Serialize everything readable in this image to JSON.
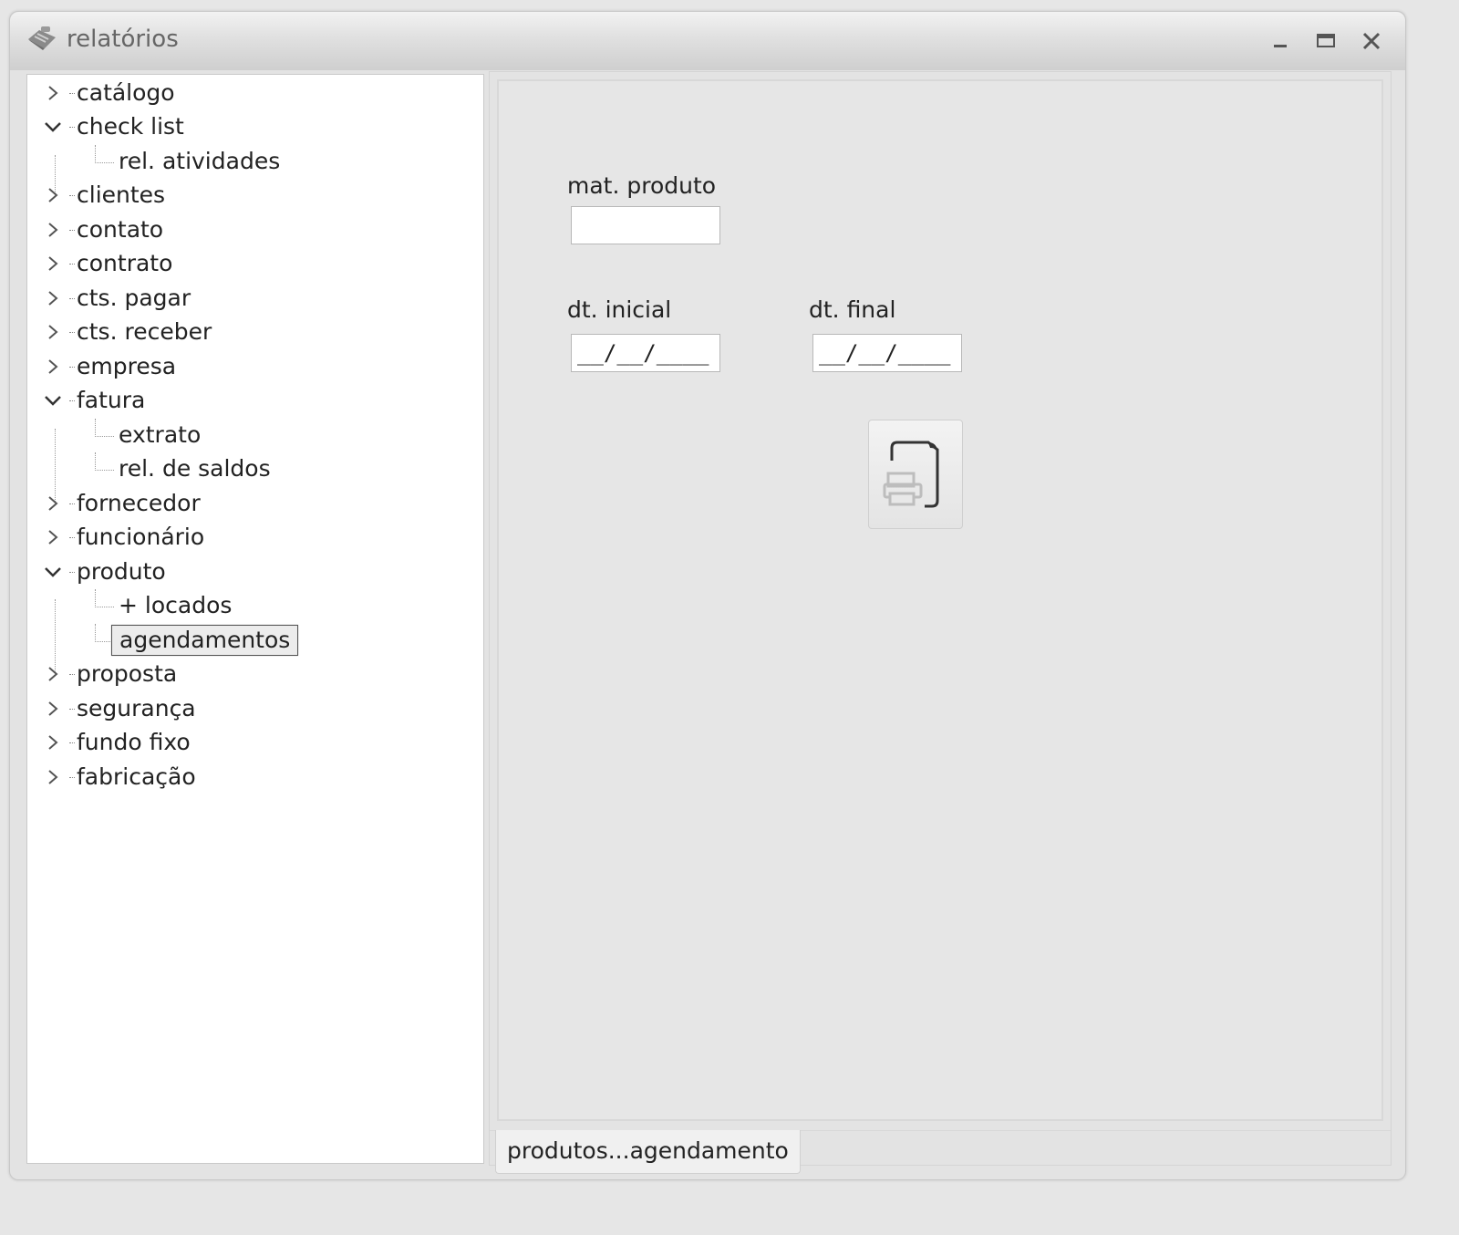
{
  "window": {
    "title": "relatórios",
    "app_icon": "stamp-icon",
    "controls": [
      "minimize-icon",
      "maximize-icon",
      "close-icon"
    ]
  },
  "tree": {
    "items": [
      {
        "label": "catálogo",
        "expanded": false
      },
      {
        "label": "check list",
        "expanded": true,
        "children": [
          "rel. atividades"
        ]
      },
      {
        "label": "clientes",
        "expanded": false
      },
      {
        "label": "contato",
        "expanded": false
      },
      {
        "label": "contrato",
        "expanded": false
      },
      {
        "label": "cts. pagar",
        "expanded": false
      },
      {
        "label": "cts. receber",
        "expanded": false
      },
      {
        "label": "empresa",
        "expanded": false
      },
      {
        "label": "fatura",
        "expanded": true,
        "children": [
          "extrato",
          "rel. de saldos"
        ]
      },
      {
        "label": "fornecedor",
        "expanded": false
      },
      {
        "label": "funcionário",
        "expanded": false
      },
      {
        "label": "produto",
        "expanded": true,
        "children": [
          "+ locados",
          "agendamentos"
        ]
      },
      {
        "label": "proposta",
        "expanded": false
      },
      {
        "label": "segurança",
        "expanded": false
      },
      {
        "label": "fundo fixo",
        "expanded": false
      },
      {
        "label": "fabricação",
        "expanded": false
      }
    ],
    "selected": "agendamentos"
  },
  "form": {
    "mat_produto_label": "mat. produto",
    "mat_produto_value": "",
    "dt_inicial_label": "dt. inicial",
    "dt_inicial_value": "__/__/____",
    "dt_final_label": "dt. final",
    "dt_final_value": "__/__/____",
    "print_button_icon": "print-report-icon"
  },
  "tab": {
    "label": "produtos...agendamento"
  }
}
